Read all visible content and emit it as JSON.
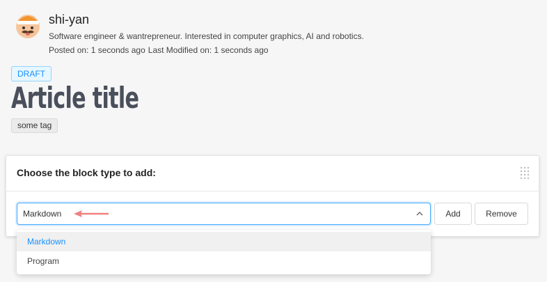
{
  "author": {
    "name": "shi-yan",
    "bio": "Software engineer & wantrepreneur. Interested in computer graphics, AI and robotics.",
    "posted": "Posted on: 1 seconds ago",
    "modified": "Last Modified on: 1 seconds ago"
  },
  "article": {
    "status": "DRAFT",
    "title": "Article title",
    "tag": "some tag"
  },
  "block_picker": {
    "title": "Choose the block type to add:",
    "selected": "Markdown",
    "add_label": "Add",
    "remove_label": "Remove",
    "options": [
      "Markdown",
      "Program"
    ]
  },
  "icons": {
    "avatar": "avatar-face-icon",
    "drag": "drag-handle-icon",
    "select_arrow": "chevron-up-icon",
    "pointer": "arrow-left-icon"
  },
  "colors": {
    "accent": "#1890ff",
    "pointer_arrow": "#f08080",
    "title": "#4a4f5c"
  }
}
